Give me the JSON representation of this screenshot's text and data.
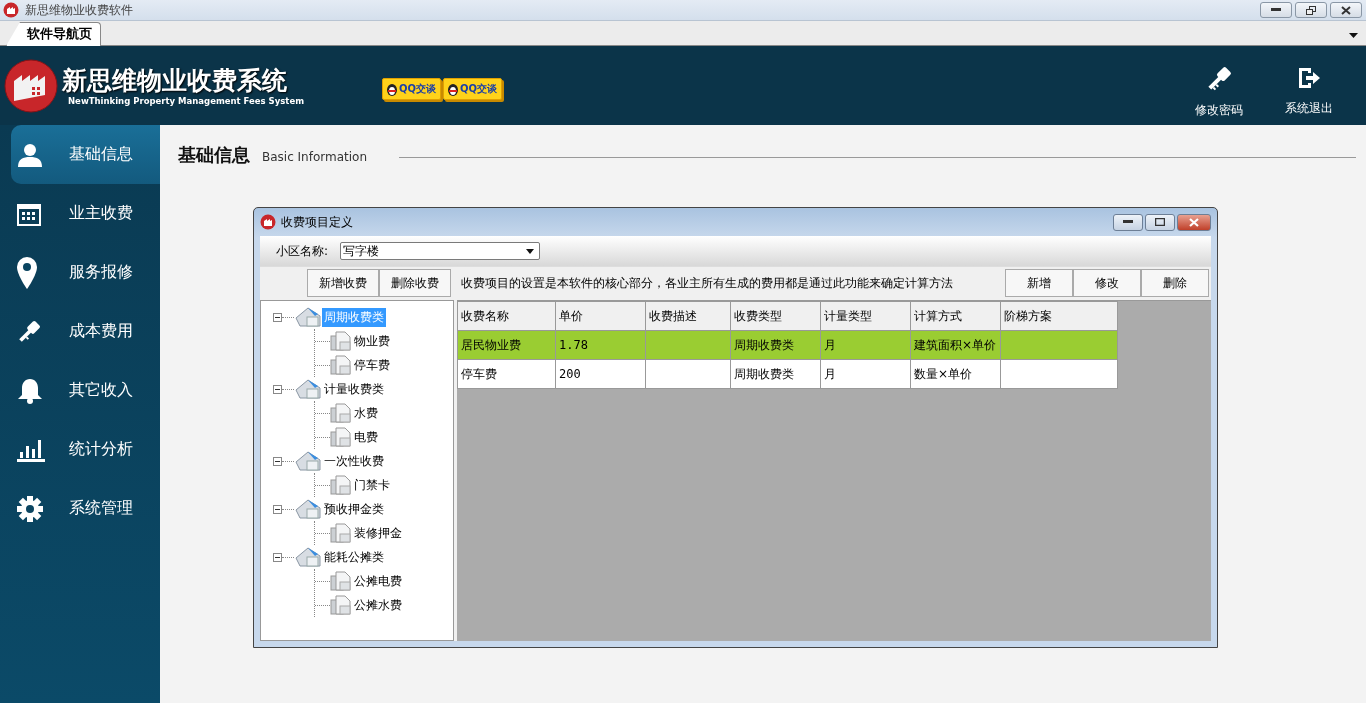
{
  "window": {
    "title": "新思维物业收费软件"
  },
  "tabs": [
    {
      "label": "软件导航页",
      "selected": true
    }
  ],
  "header": {
    "app_title": "新思维物业收费系统",
    "app_subtitle": "NewThinking  Property Management Fees System",
    "qq_buttons": [
      "QQ交谈",
      "QQ交谈"
    ],
    "actions": [
      "修改密码",
      "系统退出"
    ]
  },
  "sidebar": {
    "items": [
      {
        "label": "基础信息",
        "selected": true
      },
      {
        "label": "业主收费",
        "selected": false
      },
      {
        "label": "服务报修",
        "selected": false
      },
      {
        "label": "成本费用",
        "selected": false
      },
      {
        "label": "其它收入",
        "selected": false
      },
      {
        "label": "统计分析",
        "selected": false
      },
      {
        "label": "系统管理",
        "selected": false
      }
    ]
  },
  "section": {
    "title": "基础信息",
    "subtitle": "Basic Information"
  },
  "dialog": {
    "title": "收费项目定义",
    "community_label": "小区名称:",
    "community_value": "写字楼",
    "left_buttons": [
      "新增收费",
      "删除收费"
    ],
    "hint": "收费项目的设置是本软件的核心部分，各业主所有生成的费用都是通过此功能来确定计算方法",
    "right_buttons": [
      "新增",
      "修改",
      "删除"
    ],
    "tree": [
      {
        "label": "周期收费类",
        "selected": true,
        "expanded": true,
        "children": [
          {
            "label": "物业费",
            "selected": false
          },
          {
            "label": "停车费",
            "selected": false
          }
        ]
      },
      {
        "label": "计量收费类",
        "selected": false,
        "expanded": true,
        "children": [
          {
            "label": "水费",
            "selected": false
          },
          {
            "label": "电费",
            "selected": false
          }
        ]
      },
      {
        "label": "一次性收费",
        "selected": false,
        "expanded": true,
        "children": [
          {
            "label": "门禁卡",
            "selected": false
          }
        ]
      },
      {
        "label": "预收押金类",
        "selected": false,
        "expanded": true,
        "children": [
          {
            "label": "装修押金",
            "selected": false
          }
        ]
      },
      {
        "label": "能耗公摊类",
        "selected": false,
        "expanded": true,
        "children": [
          {
            "label": "公摊电费",
            "selected": false
          },
          {
            "label": "公摊水费",
            "selected": false
          }
        ]
      }
    ],
    "table": {
      "columns": [
        "收费名称",
        "单价",
        "收费描述",
        "收费类型",
        "计量类型",
        "计算方式",
        "阶梯方案"
      ],
      "rows": [
        {
          "selected": true,
          "cells": [
            "居民物业费",
            "1.78",
            "",
            "周期收费类",
            "月",
            "建筑面积×单价",
            ""
          ]
        },
        {
          "selected": false,
          "cells": [
            "停车费",
            "200",
            "",
            "周期收费类",
            "月",
            "数量×单价",
            ""
          ]
        }
      ]
    }
  }
}
